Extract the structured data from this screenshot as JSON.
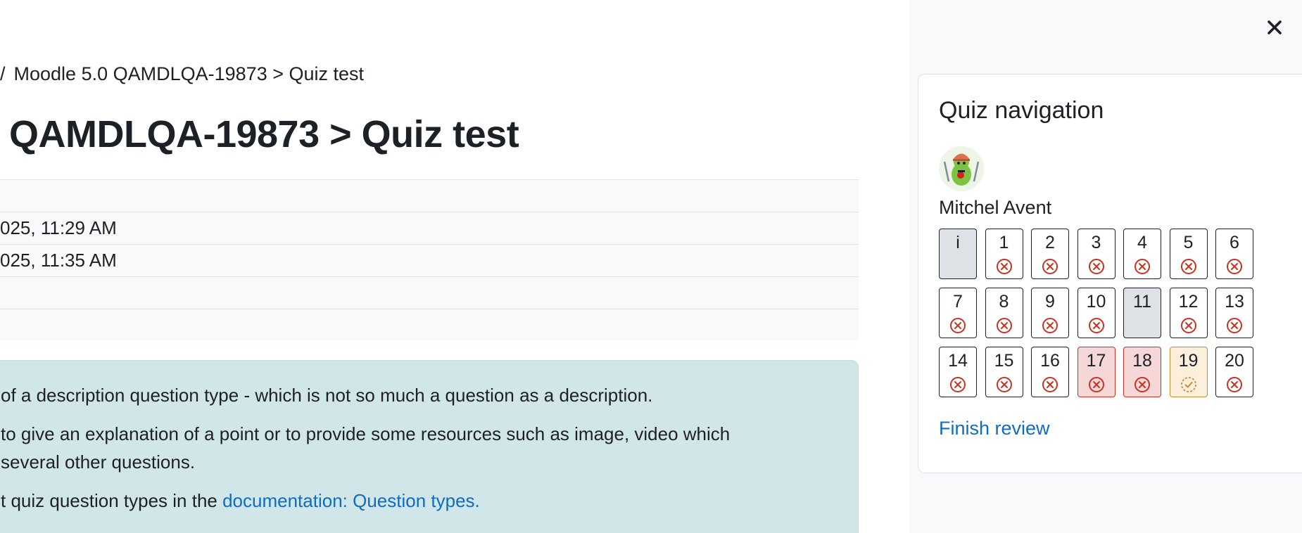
{
  "breadcrumb": {
    "separator": "/",
    "text": "Moodle 5.0 QAMDLQA-19873 > Quiz test"
  },
  "page_title": "QAMDLQA-19873 > Quiz test",
  "summary_rows": [
    "",
    "025, 11:29 AM",
    "025, 11:35 AM",
    "",
    ""
  ],
  "description": {
    "line1": "of a description question type - which is not so much a question as a description.",
    "line2": " to give an explanation of a point or to provide some resources such as image, video which",
    "line3": "several other questions.",
    "line4_prefix": "t quiz question types in the ",
    "line4_link": "documentation: Question types."
  },
  "drawer": {
    "close_icon": "close-icon",
    "title": "Quiz navigation",
    "user_name": "Mitchel Avent",
    "finish_label": "Finish review",
    "questions": [
      {
        "label": "i",
        "status": "info"
      },
      {
        "label": "1",
        "status": "incorrect"
      },
      {
        "label": "2",
        "status": "incorrect"
      },
      {
        "label": "3",
        "status": "incorrect"
      },
      {
        "label": "4",
        "status": "incorrect"
      },
      {
        "label": "5",
        "status": "incorrect"
      },
      {
        "label": "6",
        "status": "incorrect"
      },
      {
        "label": "7",
        "status": "incorrect"
      },
      {
        "label": "8",
        "status": "incorrect"
      },
      {
        "label": "9",
        "status": "incorrect"
      },
      {
        "label": "10",
        "status": "incorrect"
      },
      {
        "label": "11",
        "status": "current"
      },
      {
        "label": "12",
        "status": "incorrect"
      },
      {
        "label": "13",
        "status": "incorrect"
      },
      {
        "label": "14",
        "status": "incorrect"
      },
      {
        "label": "15",
        "status": "incorrect"
      },
      {
        "label": "16",
        "status": "incorrect"
      },
      {
        "label": "17",
        "status": "incorrect-flagged"
      },
      {
        "label": "18",
        "status": "incorrect-flagged"
      },
      {
        "label": "19",
        "status": "partial"
      },
      {
        "label": "20",
        "status": "incorrect"
      }
    ]
  },
  "colors": {
    "link": "#0f6cbf",
    "incorrect": "#ca3120",
    "partial": "#ca8a36",
    "description_bg": "#d1e6e9",
    "flagged_bg": "#f6d7d7",
    "partial_bg": "#fcefdc"
  }
}
